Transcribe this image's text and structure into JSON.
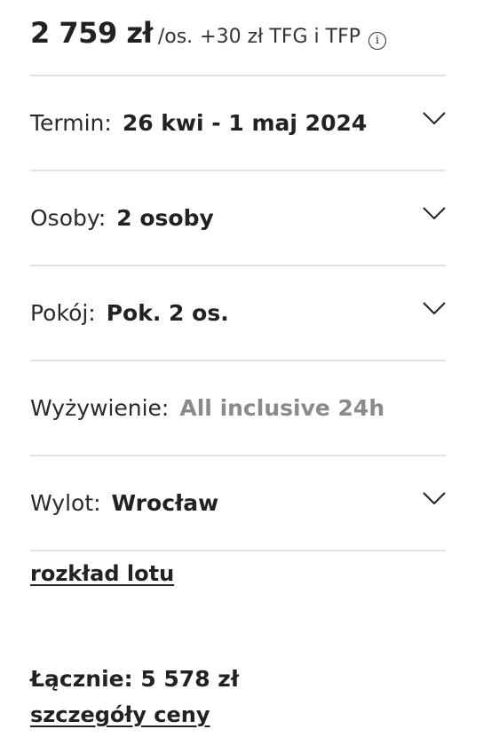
{
  "price": {
    "amount": "2 759 zł",
    "per_unit": "/os.",
    "extra": "+30 zł TFG i TFP",
    "info_icon": "info-icon"
  },
  "rows": [
    {
      "label": "Termin:",
      "value": "26 kwi - 1 maj 2024",
      "expandable": true
    },
    {
      "label": "Osoby:",
      "value": "2 osoby",
      "expandable": true
    },
    {
      "label": "Pokój:",
      "value": "Pok. 2 os.",
      "expandable": true
    },
    {
      "label": "Wyżywienie:",
      "value": "All inclusive 24h",
      "expandable": false
    },
    {
      "label": "Wylot:",
      "value": "Wrocław",
      "expandable": true
    }
  ],
  "flight_schedule_link": "rozkład lotu",
  "total": {
    "text": "Łącznie: 5 578 zł"
  },
  "price_details_link": "szczegóły ceny",
  "colors": {
    "text": "#222222",
    "muted": "#8a8a8a",
    "divider": "#e2e2e2"
  }
}
